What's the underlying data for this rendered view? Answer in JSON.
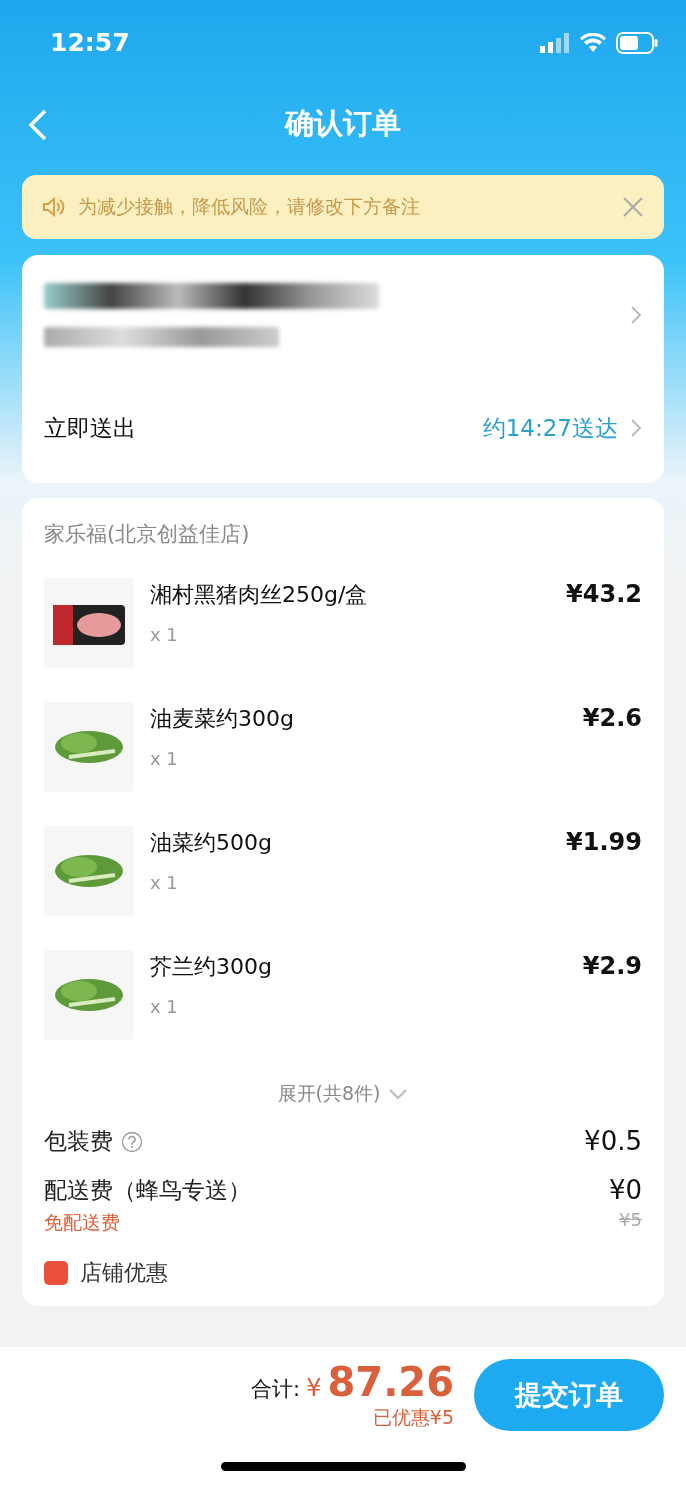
{
  "status_bar": {
    "time": "12:57"
  },
  "header": {
    "title": "确认订单"
  },
  "notice": {
    "text": "为减少接触，降低风险，请修改下方备注"
  },
  "delivery": {
    "label": "立即送出",
    "eta": "约14:27送达"
  },
  "store": {
    "name": "家乐福(北京创益佳店)",
    "items": [
      {
        "name": "湘村黑猪肉丝250g/盒",
        "qty": "x 1",
        "price": "¥43.2",
        "kind": "meat"
      },
      {
        "name": "油麦菜约300g",
        "qty": "x 1",
        "price": "¥2.6",
        "kind": "greens"
      },
      {
        "name": "油菜约500g",
        "qty": "x 1",
        "price": "¥1.99",
        "kind": "greens"
      },
      {
        "name": "芥兰约300g",
        "qty": "x 1",
        "price": "¥2.9",
        "kind": "greens"
      }
    ],
    "expand": "展开(共8件)"
  },
  "fees": [
    {
      "label": "包装费",
      "price": "¥0.5",
      "help": true
    },
    {
      "label": "配送费（蜂鸟专送）",
      "price": "¥0",
      "help": false,
      "note": "免配送费",
      "original_price": "¥5"
    }
  ],
  "discount": {
    "label": "店铺优惠"
  },
  "bottom_bar": {
    "total_label": "合计:",
    "currency": "¥",
    "total": "87.26",
    "saved": "已优惠¥5",
    "submit": "提交订单"
  }
}
